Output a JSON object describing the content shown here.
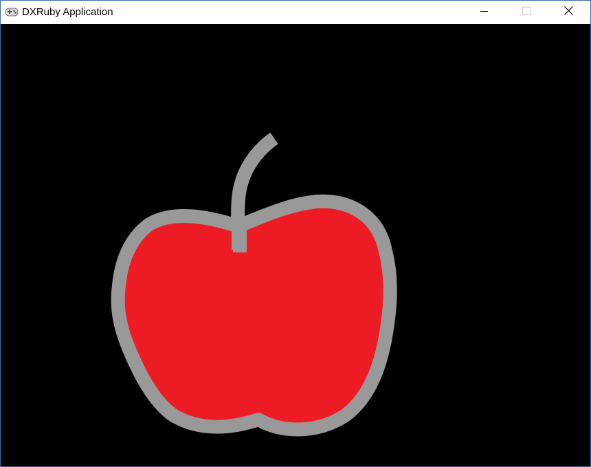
{
  "window": {
    "title": "DXRuby Application",
    "app_icon": "gamepad-icon"
  },
  "controls": {
    "minimize_icon": "minimize-icon",
    "maximize_icon": "maximize-icon",
    "close_icon": "close-icon"
  },
  "canvas": {
    "background_color": "#000000",
    "drawing": {
      "subject_icon": "apple-drawing",
      "fill_color": "#ed1c24",
      "outline_color": "#999999"
    }
  }
}
